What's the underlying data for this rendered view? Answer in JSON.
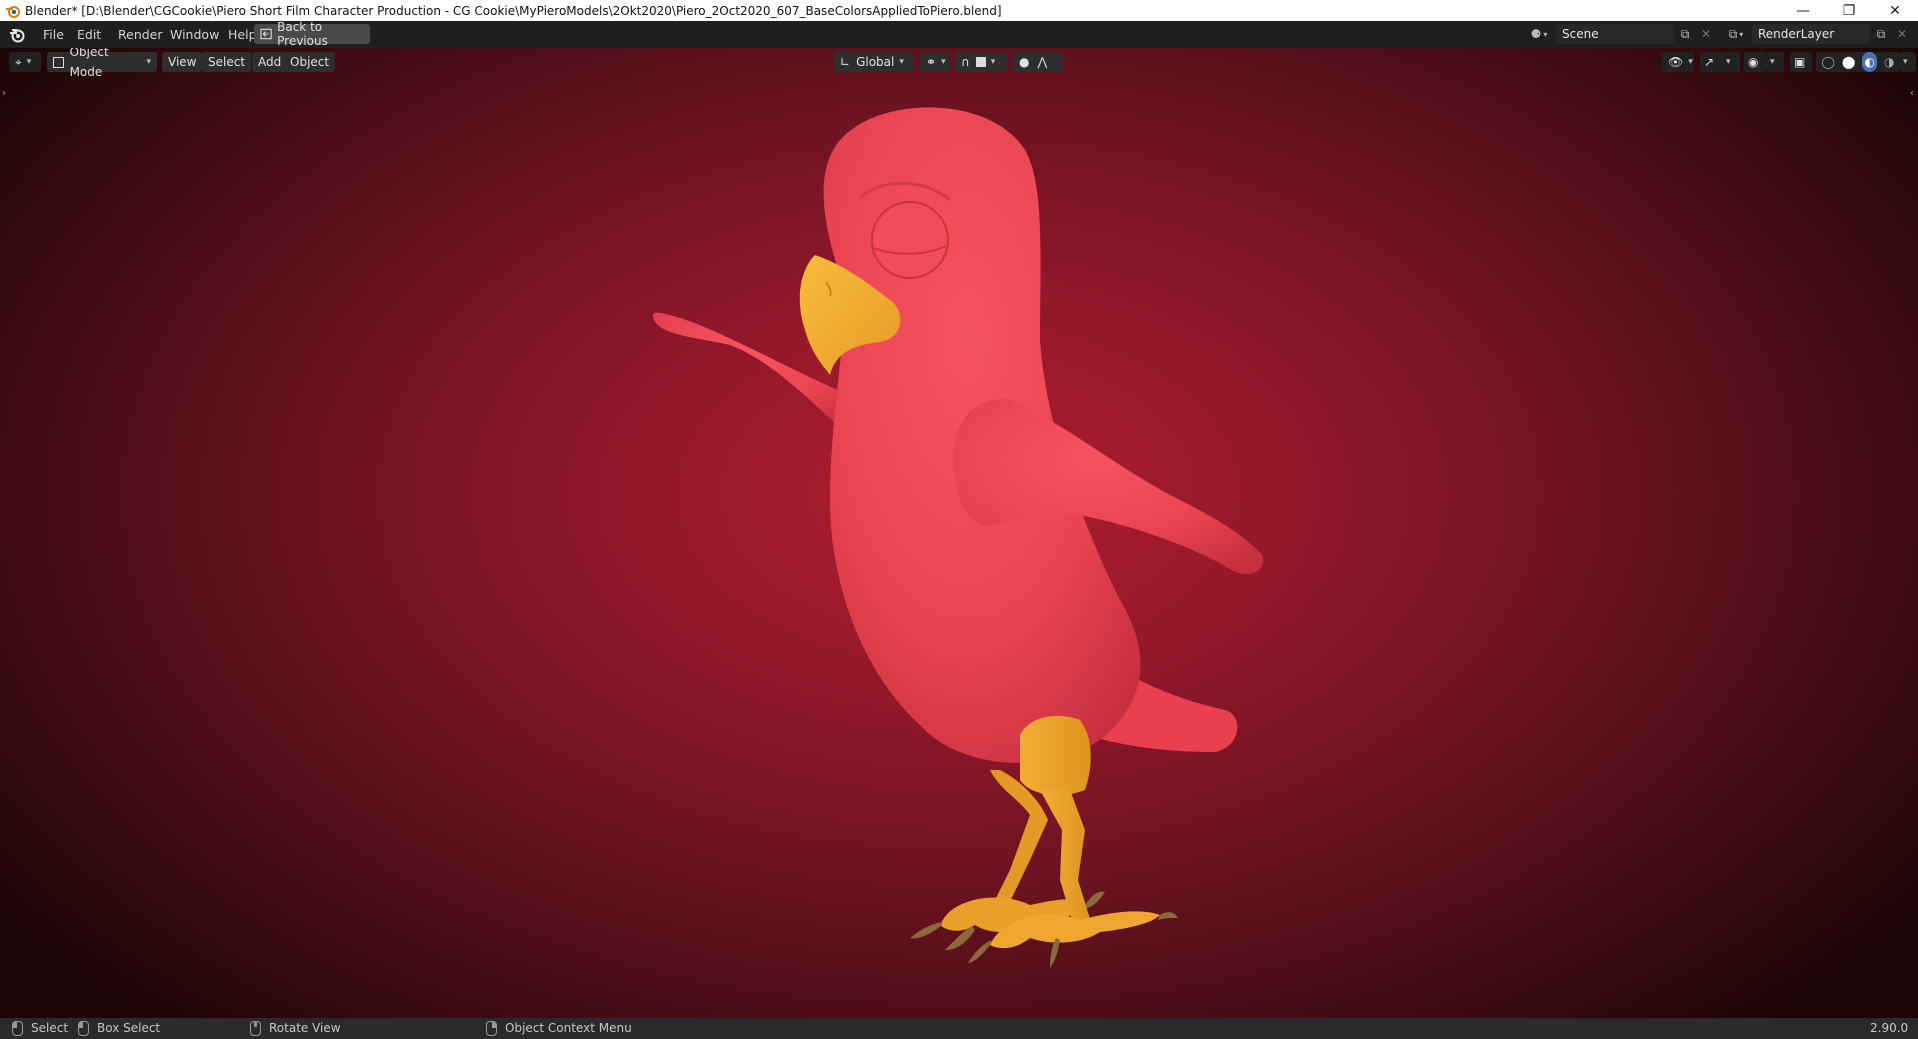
{
  "window": {
    "title": "Blender* [D:\\Blender\\CGCookie\\Piero Short Film Character Production - CG Cookie\\MyPieroModels\\2Okt2020\\Piero_2Oct2020_607_BaseColorsAppliedToPiero.blend]",
    "controls": [
      "minimize",
      "restore",
      "close"
    ]
  },
  "menubar": {
    "items": [
      "File",
      "Edit",
      "Render",
      "Window",
      "Help"
    ],
    "back_button": "Back to Previous",
    "scene_field": "Scene",
    "view_layer_field": "RenderLayer"
  },
  "viewport_header": {
    "editor_type_icon": "3d-viewport-icon",
    "mode": "Object Mode",
    "menus": [
      "View",
      "Select",
      "Add",
      "Object"
    ],
    "transform_orientation": "Global",
    "shading_mode": "solid"
  },
  "viewport": {
    "background": "red radial gradient",
    "model": "Piero bird character"
  },
  "statusbar": {
    "select": "Select",
    "box_select": "Box Select",
    "rotate_view": "Rotate View",
    "context_menu": "Object Context Menu",
    "version": "2.90.0"
  },
  "colors": {
    "body": "#ee4a56",
    "beak_feet": "#f2a933",
    "claws": "#8a6a3a"
  }
}
